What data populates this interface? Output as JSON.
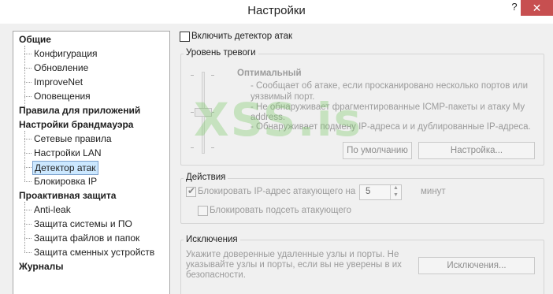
{
  "window": {
    "title": "Настройки",
    "help": "?",
    "close": "✕"
  },
  "tree": {
    "items": [
      {
        "label": "Общие",
        "level": 0
      },
      {
        "label": "Конфигурация",
        "level": 1
      },
      {
        "label": "Обновление",
        "level": 1
      },
      {
        "label": "ImproveNet",
        "level": 1
      },
      {
        "label": "Оповещения",
        "level": 1
      },
      {
        "label": "Правила для приложений",
        "level": 0
      },
      {
        "label": "Настройки брандмауэра",
        "level": 0
      },
      {
        "label": "Сетевые правила",
        "level": 1
      },
      {
        "label": "Настройки LAN",
        "level": 1
      },
      {
        "label": "Детектор атак",
        "level": 1,
        "selected": true
      },
      {
        "label": "Блокировка IP",
        "level": 1
      },
      {
        "label": "Проактивная защита",
        "level": 0
      },
      {
        "label": "Anti-leak",
        "level": 1
      },
      {
        "label": "Защита системы и ПО",
        "level": 1
      },
      {
        "label": "Защита файлов и папок",
        "level": 1
      },
      {
        "label": "Защита сменных устройств",
        "level": 1
      },
      {
        "label": "Журналы",
        "level": 0
      }
    ]
  },
  "enable_detector": {
    "label": "Включить детектор атак",
    "checked": false
  },
  "alarm_level": {
    "title": "Уровень тревоги",
    "level_name": "Оптимальный",
    "desc1": "- Сообщает об атаке, если просканировано несколько портов или",
    "desc1b": "уязвимый порт.",
    "desc2": "- Не обнаруживает фрагментированные ICMP-пакеты и атаку My",
    "desc2b": "address.",
    "desc3": "- Обнаруживает подмену IP-адреса и и дублированные IP-адреса.",
    "default_button": "По умолчанию",
    "settings_button": "Настройка..."
  },
  "actions": {
    "title": "Действия",
    "block_ip_label": "Блокировать IP-адрес атакующего на",
    "block_ip_checked": true,
    "minutes_value": "5",
    "minutes_unit": "минут",
    "block_subnet_label": "Блокировать подсеть атакующего",
    "block_subnet_checked": false
  },
  "exclusions": {
    "title": "Исключения",
    "desc1": "Укажите доверенные удаленные узлы и порты. Не",
    "desc2": "указывайте узлы и порты, если вы не уверены в их",
    "desc3": "безопасности.",
    "button": "Исключения..."
  },
  "watermark": "XSS.is",
  "colors": {
    "close_button": "#c74f50",
    "selection_bg": "#cce8ff",
    "selection_border": "#7da2ce"
  }
}
